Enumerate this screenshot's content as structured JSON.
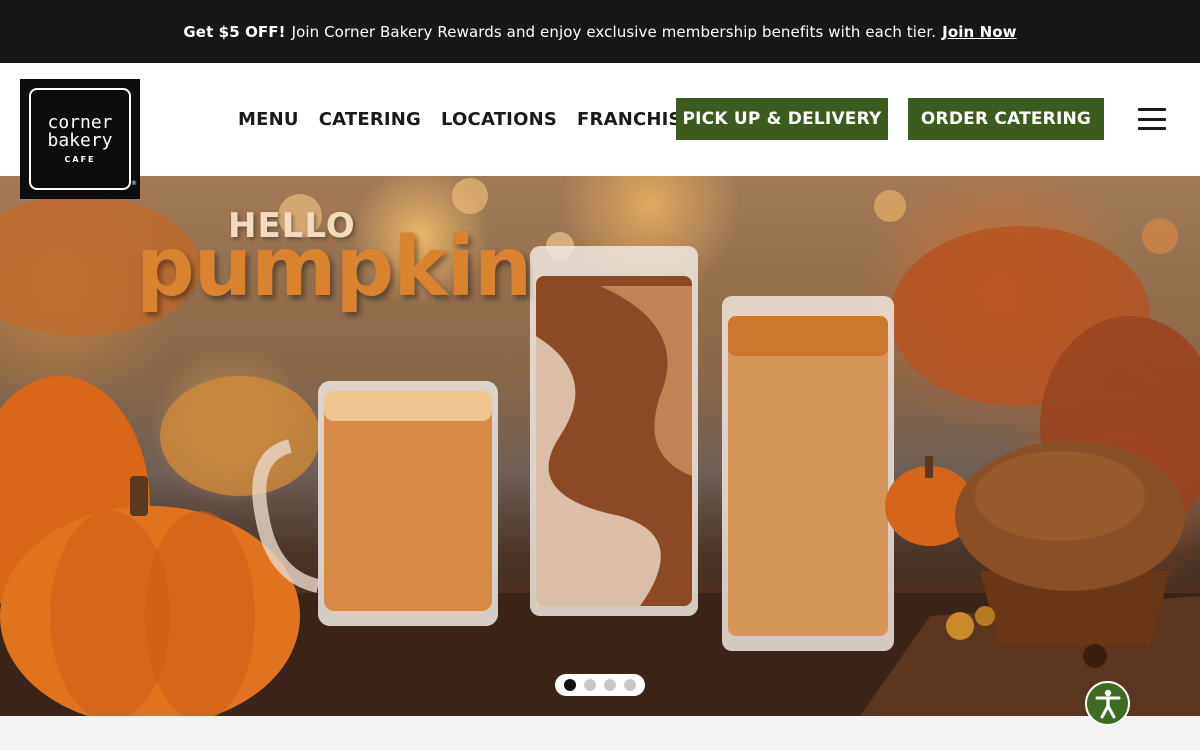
{
  "promo": {
    "bold_text": "Get $5 OFF!",
    "text": "Join Corner Bakery Rewards and enjoy exclusive membership benefits with each tier.",
    "link_label": "Join Now"
  },
  "logo": {
    "line1": "corner",
    "line2": "bakery",
    "line3": "CAFE",
    "reg": "®"
  },
  "nav": {
    "items": [
      "MENU",
      "CATERING",
      "LOCATIONS",
      "FRANCHISE"
    ],
    "pickup_label": "PICK UP & DELIVERY",
    "order_catering_label": "ORDER CATERING",
    "menu_icon": "hamburger-icon"
  },
  "hero": {
    "hello": "HELLO",
    "headline": "pumpkin",
    "slide_count": 4,
    "active_slide": 1
  },
  "accessibility": {
    "icon": "accessibility-icon"
  },
  "colors": {
    "promo_bg": "#171717",
    "brand_green": "#3d5a1f",
    "headline_orange": "#d9822f"
  }
}
